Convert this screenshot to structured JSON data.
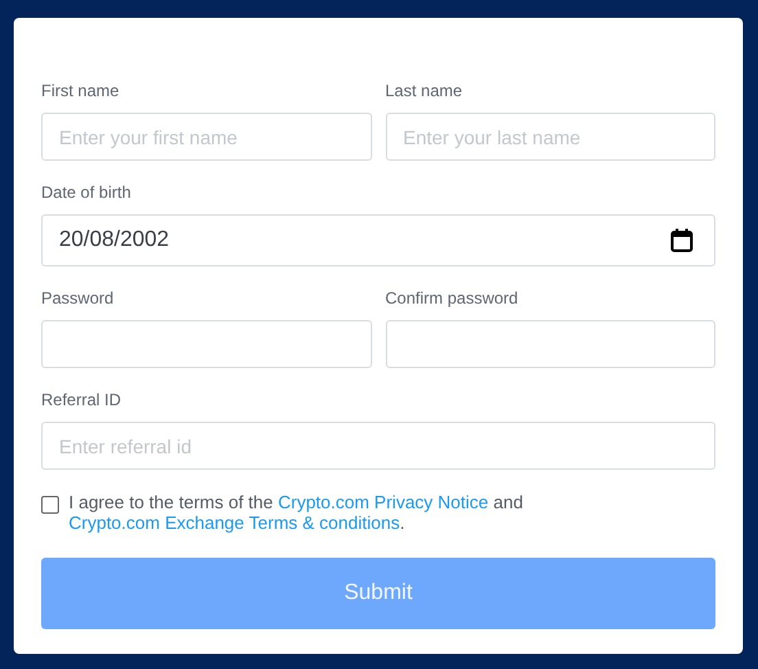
{
  "form": {
    "rows": [
      {
        "fields": [
          {
            "label": "First name",
            "kind": "text",
            "placeholder": "Enter your first name"
          },
          {
            "label": "Last name",
            "kind": "text",
            "placeholder": "Enter your last name"
          }
        ]
      },
      {
        "fields": [
          {
            "label": "Date of birth",
            "kind": "date",
            "value": "20/08/2002"
          }
        ]
      },
      {
        "fields": [
          {
            "label": "Password",
            "kind": "password"
          },
          {
            "label": "Confirm password",
            "kind": "password"
          }
        ]
      },
      {
        "fields": [
          {
            "label": "Referral ID",
            "kind": "text",
            "placeholder": "Enter referral id"
          }
        ]
      }
    ],
    "agreement": {
      "checked": false,
      "parts": [
        {
          "kind": "text",
          "text": "I agree to the terms of the"
        },
        {
          "kind": "link",
          "text": "Crypto.com Privacy Notice"
        },
        {
          "kind": "text",
          "text": "and"
        },
        {
          "kind": "link",
          "text": "Crypto.com Exchange Terms & conditions"
        },
        {
          "kind": "text",
          "text": "."
        }
      ]
    },
    "submit": {
      "label": "Submit",
      "disabled": true
    }
  }
}
